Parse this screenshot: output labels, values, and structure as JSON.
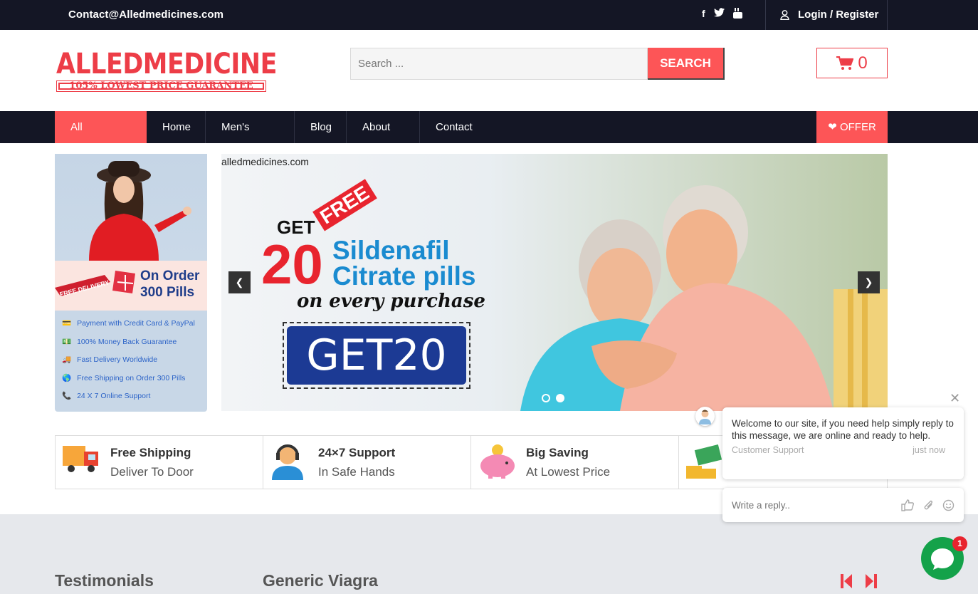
{
  "topbar": {
    "email": "Contact@Alledmedicines.com",
    "social": [
      "facebook-icon",
      "twitter-icon",
      "youtube-icon"
    ],
    "login": "Login / Register"
  },
  "header": {
    "logo_name": "ALLEDMEDICINE",
    "logo_tagline": "105% LOWEST PRICE GUARANTEE",
    "search_placeholder": "Search ...",
    "search_button": "SEARCH",
    "cart_count": "0"
  },
  "nav": {
    "items": [
      "All Categories",
      "Home",
      "Men's Health",
      "Blog",
      "About Us",
      "Contact Us"
    ],
    "offer": "OFFER"
  },
  "side_banner": {
    "promo_line1": "On Order",
    "promo_line2": "300 Pills",
    "badge": "FREE DELIVERY",
    "list": [
      "Payment with Credit Card & PayPal",
      "100% Money Back Guarantee",
      "Fast Delivery Worldwide",
      "Free Shipping on Order 300 Pills",
      "24 X 7 Online Support"
    ]
  },
  "slider": {
    "site": "alledmedicines.com",
    "get": "GET",
    "free": "FREE",
    "number": "20",
    "product_line1": "Sildenafil",
    "product_line2": "Citrate pills",
    "subline": "on every purchase",
    "coupon": "GET20"
  },
  "features": [
    {
      "title": "Free Shipping",
      "subtitle": "Deliver To Door",
      "icon": "truck-icon"
    },
    {
      "title": "24×7 Support",
      "subtitle": "In Safe Hands",
      "icon": "support-agent-icon"
    },
    {
      "title": "Big Saving",
      "subtitle": "At Lowest Price",
      "icon": "piggy-bank-icon"
    },
    {
      "title": "",
      "subtitle": "",
      "icon": "money-icon"
    }
  ],
  "footer": {
    "testimonials": "Testimonials",
    "generic": "Generic Viagra"
  },
  "chat": {
    "message": "Welcome to our site, if you need help simply reply to this message, we are online and ready to help.",
    "sender": "Customer Support",
    "time": "just now",
    "reply_placeholder": "Write a reply..",
    "badge_count": "1"
  },
  "colors": {
    "accent": "#fd5557",
    "dark": "#141625",
    "chat_green": "#14a24a"
  }
}
